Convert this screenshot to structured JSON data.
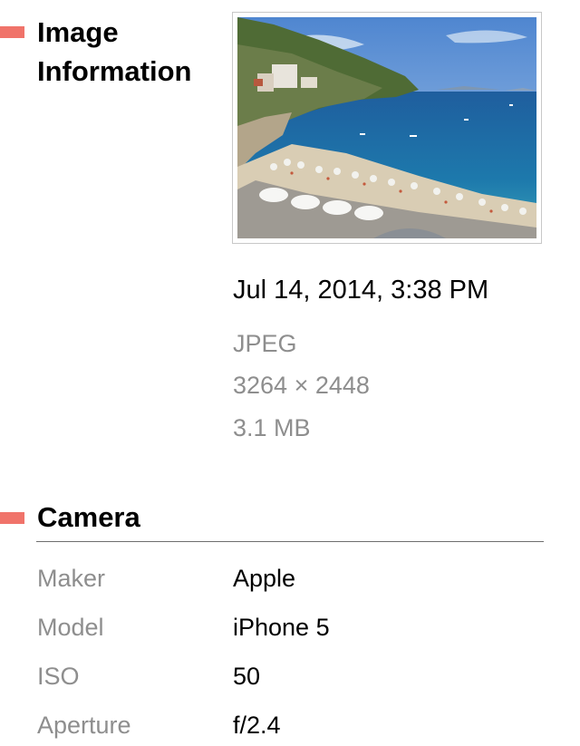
{
  "image_info": {
    "title": "Image Information",
    "date": "Jul 14, 2014, 3:38 PM",
    "format": "JPEG",
    "dimensions": "3264 × 2448",
    "file_size": "3.1 MB"
  },
  "camera": {
    "title": "Camera",
    "rows": [
      {
        "label": "Maker",
        "value": "Apple"
      },
      {
        "label": "Model",
        "value": "iPhone 5"
      },
      {
        "label": "ISO",
        "value": "50"
      },
      {
        "label": "Aperture",
        "value": "f/2.4"
      }
    ]
  },
  "colors": {
    "section_marker": "#f0736a",
    "secondary_text": "#8e8e8e",
    "primary_text": "#000000"
  }
}
